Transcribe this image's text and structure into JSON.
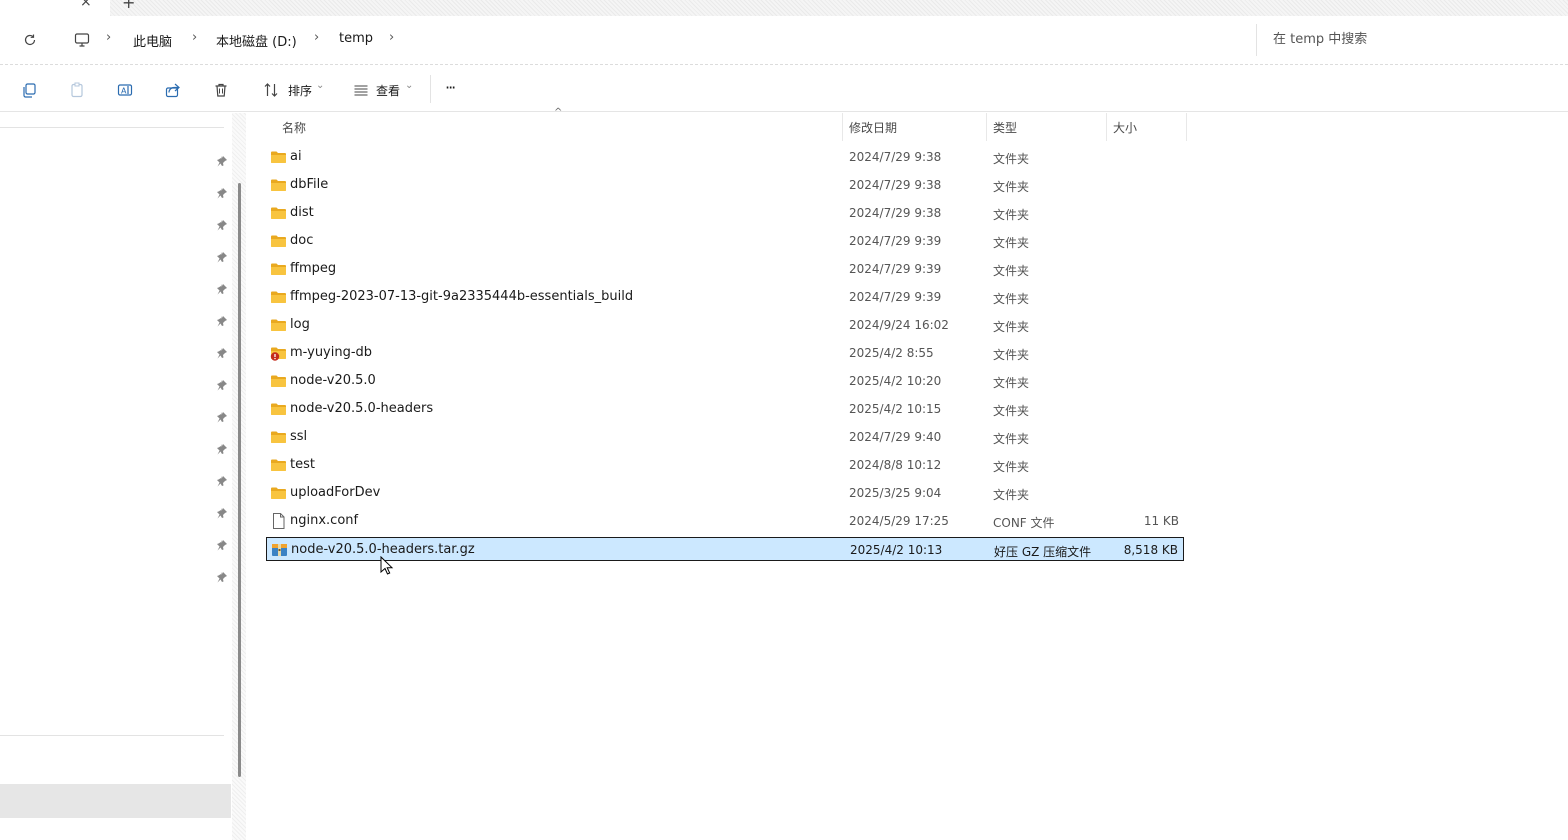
{
  "addressbar": {
    "breadcrumbs": [
      "此电脑",
      "本地磁盘 (D:)",
      "temp"
    ],
    "search_placeholder": "在 temp 中搜索"
  },
  "toolbar": {
    "sort_label": "排序",
    "view_label": "查看",
    "more_label": "···"
  },
  "columns": {
    "name": "名称",
    "date": "修改日期",
    "type": "类型",
    "size": "大小"
  },
  "files": [
    {
      "name": "ai",
      "date": "2024/7/29 9:38",
      "type": "文件夹",
      "size": "",
      "icon": "folder-icon"
    },
    {
      "name": "dbFile",
      "date": "2024/7/29 9:38",
      "type": "文件夹",
      "size": "",
      "icon": "folder-icon"
    },
    {
      "name": "dist",
      "date": "2024/7/29 9:38",
      "type": "文件夹",
      "size": "",
      "icon": "folder-icon"
    },
    {
      "name": "doc",
      "date": "2024/7/29 9:39",
      "type": "文件夹",
      "size": "",
      "icon": "folder-icon"
    },
    {
      "name": "ffmpeg",
      "date": "2024/7/29 9:39",
      "type": "文件夹",
      "size": "",
      "icon": "folder-icon"
    },
    {
      "name": "ffmpeg-2023-07-13-git-9a2335444b-essentials_build",
      "date": "2024/7/29 9:39",
      "type": "文件夹",
      "size": "",
      "icon": "folder-icon"
    },
    {
      "name": "log",
      "date": "2024/9/24 16:02",
      "type": "文件夹",
      "size": "",
      "icon": "folder-icon"
    },
    {
      "name": "m-yuying-db",
      "date": "2025/4/2 8:55",
      "type": "文件夹",
      "size": "",
      "icon": "folder-error-icon"
    },
    {
      "name": "node-v20.5.0",
      "date": "2025/4/2 10:20",
      "type": "文件夹",
      "size": "",
      "icon": "folder-icon"
    },
    {
      "name": "node-v20.5.0-headers",
      "date": "2025/4/2 10:15",
      "type": "文件夹",
      "size": "",
      "icon": "folder-icon"
    },
    {
      "name": "ssl",
      "date": "2024/7/29 9:40",
      "type": "文件夹",
      "size": "",
      "icon": "folder-icon"
    },
    {
      "name": "test",
      "date": "2024/8/8 10:12",
      "type": "文件夹",
      "size": "",
      "icon": "folder-icon"
    },
    {
      "name": "uploadForDev",
      "date": "2025/3/25 9:04",
      "type": "文件夹",
      "size": "",
      "icon": "folder-icon"
    },
    {
      "name": "nginx.conf",
      "date": "2024/5/29 17:25",
      "type": "CONF 文件",
      "size": "11 KB",
      "icon": "file-icon"
    },
    {
      "name": "node-v20.5.0-headers.tar.gz",
      "date": "2025/4/2 10:13",
      "type": "好压 GZ 压缩文件",
      "size": "8,518 KB",
      "icon": "archive-icon",
      "selected": true
    }
  ],
  "colors": {
    "selection_bg": "#cce8ff",
    "folder_yellow": "#f8c43f",
    "error_red": "#c42b1c"
  }
}
